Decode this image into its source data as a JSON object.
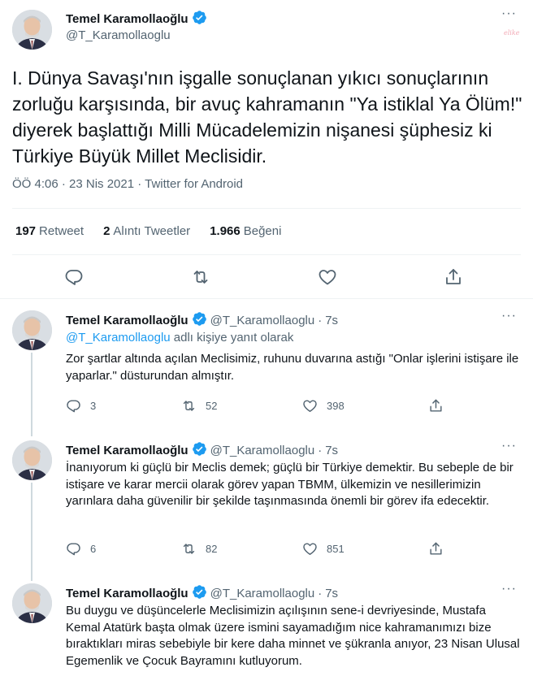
{
  "main_tweet": {
    "name": "Temel Karamollaoğlu",
    "handle": "@T_Karamollaoglu",
    "text": "I. Dünya Savaşı'nın işgalle sonuçlanan yıkıcı sonuçlarının zorluğu karşısında, bir avuç kahramanın \"Ya istiklal Ya Ölüm!\" diyerek başlattığı Milli Mücadelemizin nişanesi şüphesiz ki Türkiye Büyük Millet Meclisidir.",
    "meta": "ÖÖ 4:06 · 23 Nis 2021 · Twitter for Android",
    "stats": {
      "retweets_count": "197",
      "retweets_label": "Retweet",
      "quotes_count": "2",
      "quotes_label": "Alıntı Tweetler",
      "likes_count": "1.966",
      "likes_label": "Beğeni"
    },
    "more_label": "···",
    "watermark": "elike"
  },
  "replies": [
    {
      "name": "Temel Karamollaoğlu",
      "handle": "@T_Karamollaoglu",
      "dot": "·",
      "time": "7s",
      "reply_to_mention": "@T_Karamollaoglu",
      "reply_to_suffix": " adlı kişiye yanıt olarak",
      "text": "Zor şartlar altında açılan Meclisimiz, ruhunu duvarına astığı \"Onlar işlerini istişare ile yaparlar.\" düsturundan almıştır.",
      "reply_count": "3",
      "retweet_count": "52",
      "like_count": "398"
    },
    {
      "name": "Temel Karamollaoğlu",
      "handle": "@T_Karamollaoglu",
      "dot": "·",
      "time": "7s",
      "text": "İnanıyorum ki güçlü bir Meclis demek; güçlü bir Türkiye demektir. Bu sebeple de bir istişare ve karar mercii olarak görev yapan TBMM, ülkemizin ve nesillerimizin yarınlara daha güvenilir bir şekilde taşınmasında önemli bir görev ifa edecektir.",
      "reply_count": "6",
      "retweet_count": "82",
      "like_count": "851"
    },
    {
      "name": "Temel Karamollaoğlu",
      "handle": "@T_Karamollaoglu",
      "dot": "·",
      "time": "7s",
      "text": "Bu duygu ve düşüncelerle Meclisimizin açılışının sene-i devriyesinde, Mustafa Kemal Atatürk başta olmak üzere ismini sayamadığım nice kahramanımızı bize bıraktıkları miras sebebiyle bir kere daha minnet ve şükranla anıyor, 23 Nisan Ulusal Egemenlik ve Çocuk Bayramını kutluyorum."
    }
  ],
  "icons": {
    "verified": "verified-badge-icon",
    "reply": "reply-icon",
    "retweet": "retweet-icon",
    "like": "heart-icon",
    "share": "share-icon",
    "more": "more-icon"
  },
  "colors": {
    "accent": "#1d9bf0",
    "text": "#0f1419",
    "secondary": "#536471",
    "border": "#eff3f4"
  }
}
